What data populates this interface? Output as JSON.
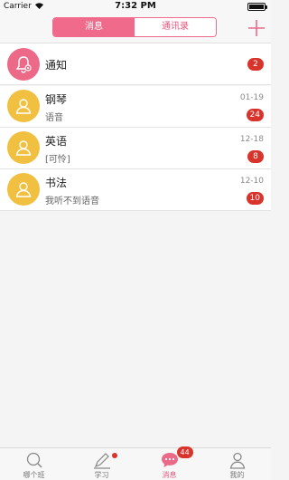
{
  "status_bar": {
    "carrier": "Carrier",
    "time": "7:32 PM"
  },
  "header": {
    "segments": [
      {
        "label": "消息",
        "active": true
      },
      {
        "label": "通讯录",
        "active": false
      }
    ],
    "add_icon": "plus-icon"
  },
  "colors": {
    "accent": "#f06a8b",
    "badge": "#d9342b",
    "avatar_yellow": "#f2c041",
    "avatar_pink": "#ec6a88"
  },
  "notice": {
    "title": "通知",
    "badge": "2",
    "icon": "bell-settings-icon"
  },
  "conversations": [
    {
      "name": "钢琴",
      "preview": "语音",
      "date": "01-19",
      "badge": "24",
      "icon": "user-icon"
    },
    {
      "name": "英语",
      "preview": "[可怜]",
      "date": "12-18",
      "badge": "8",
      "icon": "user-icon"
    },
    {
      "name": "书法",
      "preview": "我听不到语音",
      "date": "12-10",
      "badge": "10",
      "icon": "user-icon"
    }
  ],
  "tabs": [
    {
      "label": "哪个班",
      "icon": "search-icon"
    },
    {
      "label": "学习",
      "icon": "pencil-icon",
      "dot": true
    },
    {
      "label": "消息",
      "icon": "chat-bubble-icon",
      "badge": "44",
      "active": true
    },
    {
      "label": "我的",
      "icon": "person-icon"
    }
  ]
}
